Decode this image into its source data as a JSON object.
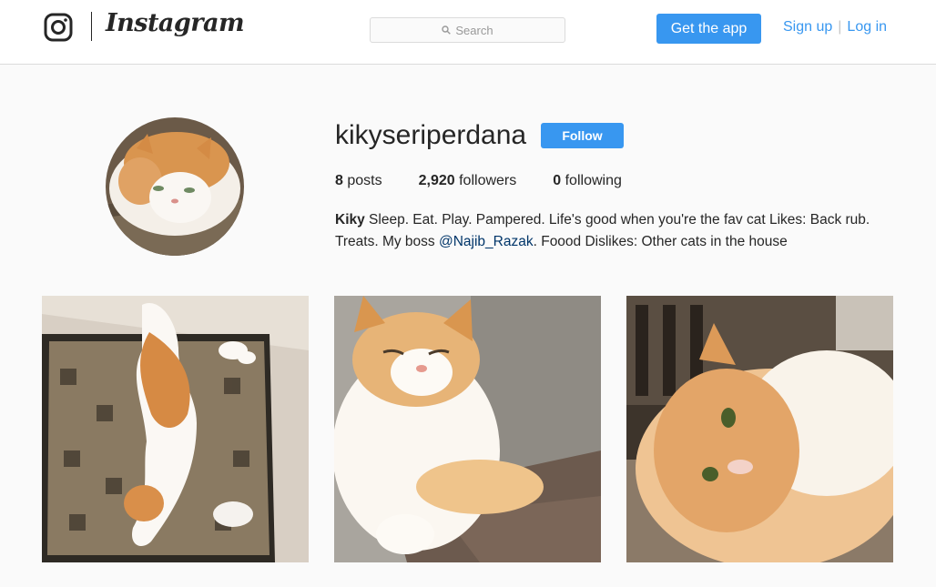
{
  "header": {
    "brand": "Instagram",
    "search_placeholder": "Search",
    "get_app": "Get the app",
    "sign_up": "Sign up",
    "separator": "|",
    "log_in": "Log in"
  },
  "profile": {
    "username": "kikyseriperdana",
    "follow": "Follow",
    "stats": [
      {
        "value": "8",
        "label": "posts"
      },
      {
        "value": "2,920",
        "label": "followers"
      },
      {
        "value": "0",
        "label": "following"
      }
    ],
    "bio_name": "Kiky",
    "bio_text_1": " Sleep. Eat. Play. Pampered. Life's good when you're the fav cat Likes: Back rub. Treats. My boss ",
    "bio_mention": "@Najib_Razak",
    "bio_text_2": ". Foood Dislikes: Other cats in the house"
  },
  "posts": [
    {
      "alt": "cat lying on patterned rug"
    },
    {
      "alt": "cat squinting by wall"
    },
    {
      "alt": "cat lying on floor close-up"
    }
  ],
  "colors": {
    "accent": "#3897f0",
    "mention": "#003569",
    "border": "#dbdbdb"
  }
}
